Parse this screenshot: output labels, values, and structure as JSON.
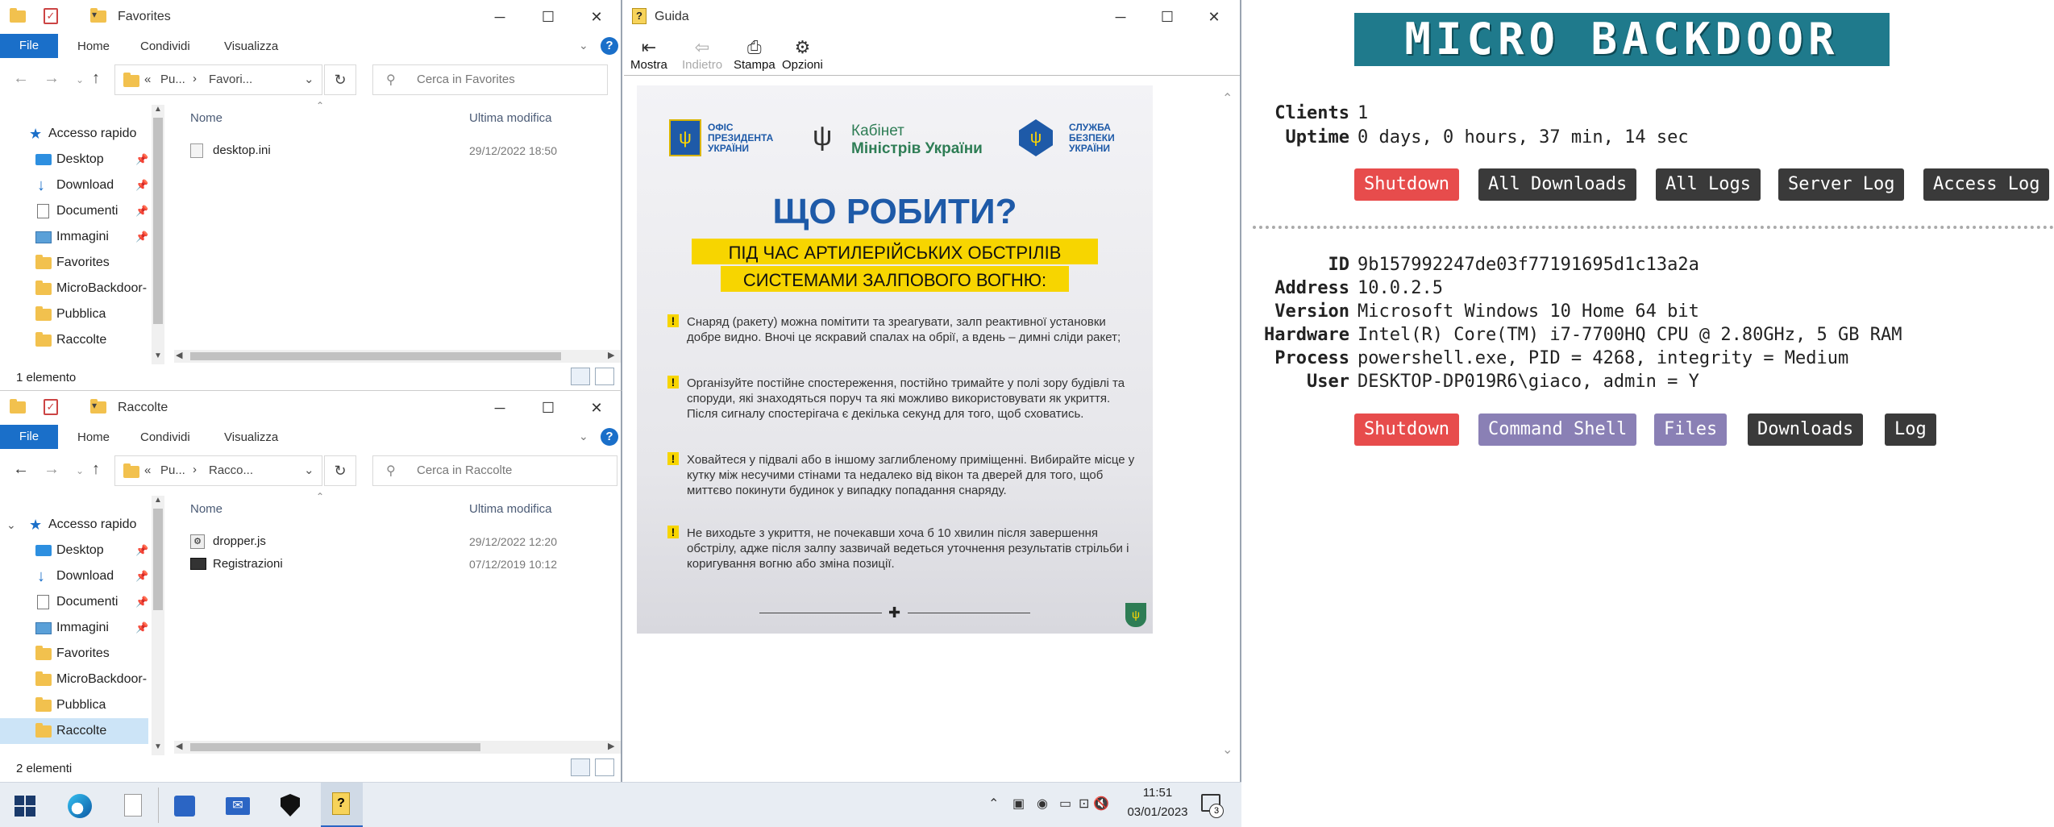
{
  "explorer_top": {
    "title": "Favorites",
    "tabs": {
      "file": "File",
      "home": "Home",
      "share": "Condividi",
      "view": "Visualizza"
    },
    "breadcrumb": {
      "chev": "«",
      "part1": "Pu...",
      "sep": "›",
      "part2": "Favori..."
    },
    "search_placeholder": "Cerca in Favorites",
    "nav": {
      "quick": "Accesso rapido",
      "items": [
        "Desktop",
        "Download",
        "Documenti",
        "Immagini",
        "Favorites",
        "MicroBackdoor-",
        "Pubblica",
        "Raccolte"
      ]
    },
    "columns": {
      "name": "Nome",
      "modified": "Ultima modifica"
    },
    "files": [
      {
        "name": "desktop.ini",
        "date": "29/12/2022 18:50"
      }
    ],
    "status": "1 elemento"
  },
  "explorer_bottom": {
    "title": "Raccolte",
    "tabs": {
      "file": "File",
      "home": "Home",
      "share": "Condividi",
      "view": "Visualizza"
    },
    "breadcrumb": {
      "chev": "«",
      "part1": "Pu...",
      "sep": "›",
      "part2": "Racco..."
    },
    "search_placeholder": "Cerca in Raccolte",
    "nav": {
      "quick": "Accesso rapido",
      "items": [
        "Desktop",
        "Download",
        "Documenti",
        "Immagini",
        "Favorites",
        "MicroBackdoor-",
        "Pubblica",
        "Raccolte"
      ]
    },
    "columns": {
      "name": "Nome",
      "modified": "Ultima modifica"
    },
    "files": [
      {
        "name": "dropper.js",
        "date": "29/12/2022 12:20"
      },
      {
        "name": "Registrazioni",
        "date": "07/12/2019 10:12"
      }
    ],
    "status": "2 elementi"
  },
  "guida": {
    "title": "Guida",
    "toolbar": {
      "show": "Mostra",
      "back": "Indietro",
      "print": "Stampa",
      "options": "Opzioni"
    },
    "poster": {
      "logo1": "ОФІС\nПРЕЗИДЕНТА\nУКРАЇНИ",
      "logo2_a": "Кабінет",
      "logo2_b": "Міністрів України",
      "logo3": "СЛУЖБА\nБЕЗПЕКИ\nУКРАЇНИ",
      "heading": "ЩО РОБИТИ?",
      "sub1": "ПІД ЧАС АРТИЛЕРІЙСЬКИХ ОБСТРІЛІВ",
      "sub2": "СИСТЕМАМИ ЗАЛПОВОГО ВОГНЮ:",
      "items": [
        "Снаряд (ракету) можна помітити та зреагувати, залп реактивної установки добре видно. Вночі це яскравий спалах на обрії, а вдень – димні сліди ракет;",
        "Організуйте постійне спостереження, постійно тримайте у полі зору будівлі та споруди, які знаходяться поруч та які можливо використовувати як укриття. Після сигналу спостерігача є декілька секунд для того, щоб сховатись.",
        "Ховайтеся у підвалі або в іншому заглибленому приміщенні. Вибирайте місце у кутку між несучими стінами та недалеко від вікон та дверей для того, щоб миттєво покинути будинок у випадку попадання снаряду.",
        "Не виходьте з укриття, не почекавши хоча б 10 хвилин після завершення обстрілу, адже після залпу зазвичай ведеться уточнення результатів стрільби і коригування вогню або зміна позиції."
      ]
    }
  },
  "taskbar": {
    "time": "11:51",
    "date": "03/01/2023",
    "notif_count": "3"
  },
  "backdoor": {
    "logo": "MICRO BACKDOOR",
    "server": {
      "clients_label": "Clients",
      "clients": "1",
      "uptime_label": "Uptime",
      "uptime": "0 days, 0 hours, 37 min, 14 sec"
    },
    "server_buttons": [
      "Shutdown",
      "All Downloads",
      "All Logs",
      "Server Log",
      "Access Log"
    ],
    "client": {
      "id_label": "ID",
      "id": "9b157992247de03f77191695d1c13a2a",
      "address_label": "Address",
      "address": "10.0.2.5",
      "version_label": "Version",
      "version": "Microsoft Windows 10 Home 64 bit",
      "hardware_label": "Hardware",
      "hardware": "Intel(R) Core(TM) i7-7700HQ CPU @ 2.80GHz, 5 GB RAM",
      "process_label": "Process",
      "process": "powershell.exe, PID = 4268, integrity = Medium",
      "user_label": "User",
      "user": "DESKTOP-DP019R6\\giaco, admin = Y"
    },
    "client_buttons": [
      "Shutdown",
      "Command Shell",
      "Files",
      "Downloads",
      "Log"
    ]
  }
}
